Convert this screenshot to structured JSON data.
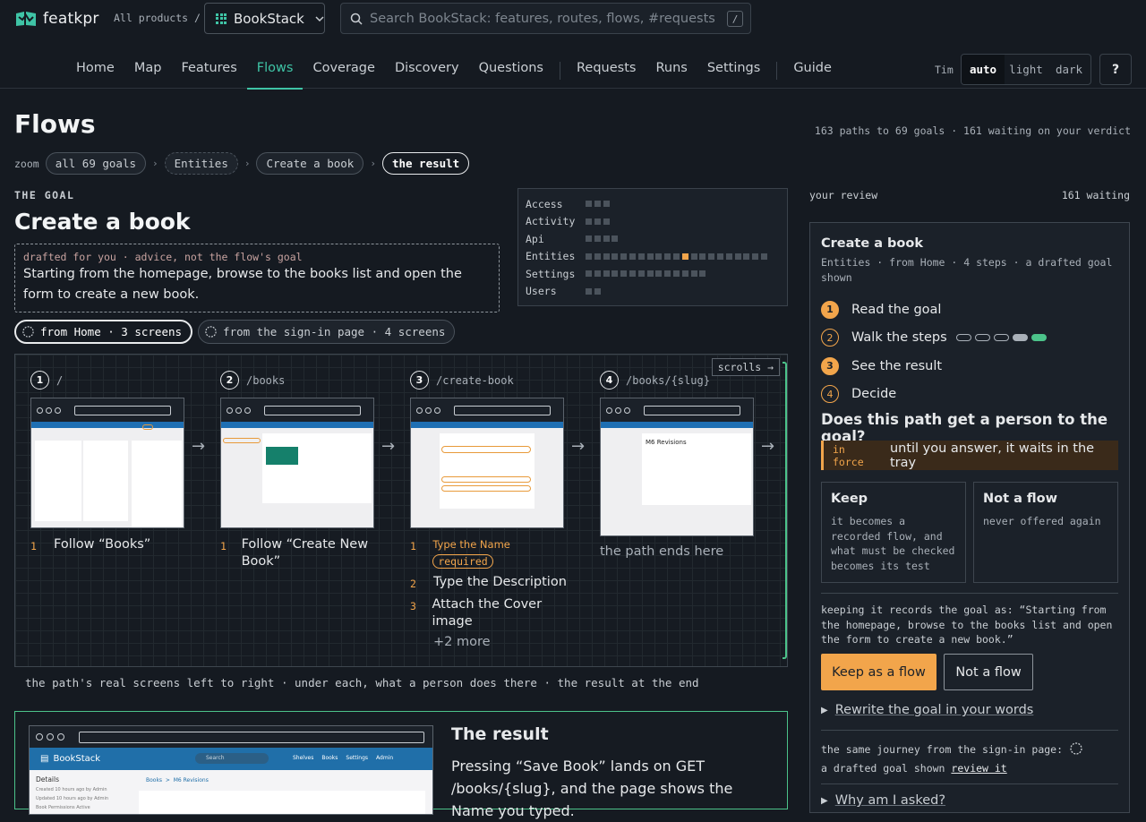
{
  "header": {
    "brand": "featkpr",
    "all_products": "All products /",
    "product": "BookStack",
    "search_placeholder": "Search BookStack: features, routes, flows, #requests",
    "search_kbd": "/",
    "nav": [
      "Home",
      "Map",
      "Features",
      "Flows",
      "Coverage",
      "Discovery",
      "Questions",
      "Requests",
      "Runs",
      "Settings",
      "Guide"
    ],
    "nav_active": "Flows",
    "user": "Tim",
    "theme": [
      "auto",
      "light",
      "dark"
    ],
    "theme_selected": "auto",
    "help": "?"
  },
  "page": {
    "title": "Flows",
    "stats": "163 paths to 69 goals · 161 waiting on your verdict",
    "zoom_label": "zoom",
    "breadcrumb": [
      "all 69 goals",
      "Entities",
      "Create a book",
      "the result"
    ]
  },
  "goal": {
    "kicker": "THE GOAL",
    "title": "Create a book",
    "draft_label": "drafted for you · advice, not the flow's goal",
    "draft_text": "Starting from the homepage, browse to the books list and open the form to create a new book."
  },
  "heatmap": [
    {
      "name": "Access",
      "cells": 3,
      "hot": -1
    },
    {
      "name": "Activity",
      "cells": 3,
      "hot": -1
    },
    {
      "name": "Api",
      "cells": 4,
      "hot": -1
    },
    {
      "name": "Entities",
      "cells": 21,
      "hot": 11
    },
    {
      "name": "Settings",
      "cells": 14,
      "hot": -1
    },
    {
      "name": "Users",
      "cells": 2,
      "hot": -1
    }
  ],
  "routes": [
    {
      "label": "from Home · 3 screens",
      "selected": true
    },
    {
      "label": "from the sign-in page · 4 screens",
      "selected": false
    }
  ],
  "strip": {
    "scrolls": "scrolls →",
    "steps": [
      {
        "n": "1",
        "path": "/",
        "actions": [
          {
            "n": "1",
            "text": "Follow “Books”"
          }
        ]
      },
      {
        "n": "2",
        "path": "/books",
        "actions": [
          {
            "n": "1",
            "text": "Follow “Create New Book”"
          }
        ]
      },
      {
        "n": "3",
        "path": "/create-book",
        "actions": [
          {
            "n": "1",
            "text": "Type the Name",
            "badge": "required"
          },
          {
            "n": "2",
            "text": "Type the Description"
          },
          {
            "n": "3",
            "text": "Attach the Cover image"
          }
        ],
        "more": "+2 more"
      },
      {
        "n": "4",
        "path": "/books/{slug}",
        "ends": "the path ends here"
      }
    ],
    "caption": "the path's real screens left to right · under each, what a person does there · the result at the end"
  },
  "result": {
    "title": "The result",
    "text": "Pressing “Save Book” lands on GET /books/{slug}, and the page shows the Name you typed.",
    "shot": {
      "brand": "BookStack",
      "search": "Search",
      "menu": [
        "Shelves",
        "Books",
        "Settings",
        "Admin"
      ],
      "details": "Details",
      "detail_lines": [
        "Created 10 hours ago by Admin",
        "Updated 10 hours ago by Admin",
        "Book Permissions Active"
      ],
      "crumb": [
        "Books",
        "M6 Revisions"
      ]
    }
  },
  "review": {
    "label": "your review",
    "waiting": "161 waiting",
    "title": "Create a book",
    "meta": "Entities · from Home · 4 steps · a drafted goal shown",
    "steps": [
      "Read the goal",
      "Walk the steps",
      "See the result",
      "Decide"
    ],
    "question": "Does this path get a person to the goal?",
    "inforce_tag": "in force",
    "inforce_text": "until you answer, it waits in the tray",
    "keep_title": "Keep",
    "keep_desc": "it becomes a recorded flow, and what must be checked becomes its test",
    "not_title": "Not a flow",
    "not_desc": "never offered again",
    "keeping": "keeping it records the goal as: “Starting from the homepage, browse to the books list and open the form to create a new book.”",
    "keep_btn": "Keep as a flow",
    "not_btn": "Not a flow",
    "rewrite": "Rewrite the goal in your words",
    "same_journey": "the same journey from the sign-in page:",
    "same_journey_2": "a drafted goal shown",
    "review_it": "review it",
    "why": "Why am I asked?"
  },
  "colors": {
    "accent": "#3fc4a6",
    "warn": "#f2a54b",
    "ok": "#4cc38a"
  }
}
